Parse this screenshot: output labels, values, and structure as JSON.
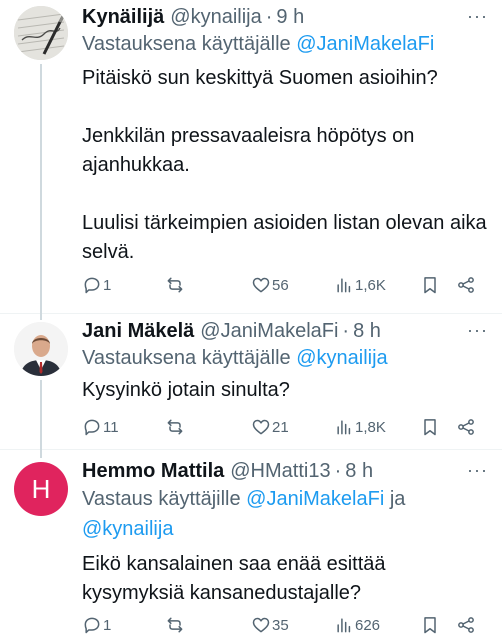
{
  "tweets": [
    {
      "name": "Kynäilijä",
      "handle": "@kynailija",
      "dot": "·",
      "time": "9 h",
      "more": "···",
      "reply_prefix": "Vastauksena käyttäjälle",
      "mention1": "@JaniMakelaFi",
      "text": "Pitäiskö sun keskittyä Suomen asioihin?\n\nJenkkilän pressavaaleisra höpötys on ajanhukkaa.\n\nLuulisi tärkeimpien asioiden listan olevan aika selvä.",
      "replies": "1",
      "retweets": "",
      "likes": "56",
      "views": "1,6K"
    },
    {
      "name": "Jani Mäkelä",
      "handle": "@JaniMakelaFi",
      "dot": "·",
      "time": "8 h",
      "more": "···",
      "reply_prefix": "Vastauksena käyttäjälle",
      "mention1": "@kynailija",
      "text": "Kysyinkö jotain sinulta?",
      "replies": "11",
      "retweets": "",
      "likes": "21",
      "views": "1,8K"
    },
    {
      "name": "Hemmo Mattila",
      "handle": "@HMatti13",
      "dot": "·",
      "time": "8 h",
      "more": "···",
      "avatar_letter": "H",
      "reply_prefix": "Vastaus käyttäjille",
      "mention1": "@JaniMakelaFi",
      "joiner": "ja",
      "mention2": "@kynailija",
      "text": "Eikö kansalainen saa enää esittää kysymyksiä kansanedustajalle?",
      "replies": "1",
      "retweets": "",
      "likes": "35",
      "views": "626"
    }
  ],
  "colors": {
    "accent": "#1d9bf0",
    "secondary_text": "#536471",
    "primary_text": "#0f1419",
    "h_avatar": "#e0245e",
    "thread_line": "#cfd9de"
  },
  "icons": [
    "reply-icon",
    "retweet-icon",
    "like-icon",
    "views-icon",
    "bookmark-icon",
    "share-icon",
    "more-icon"
  ]
}
